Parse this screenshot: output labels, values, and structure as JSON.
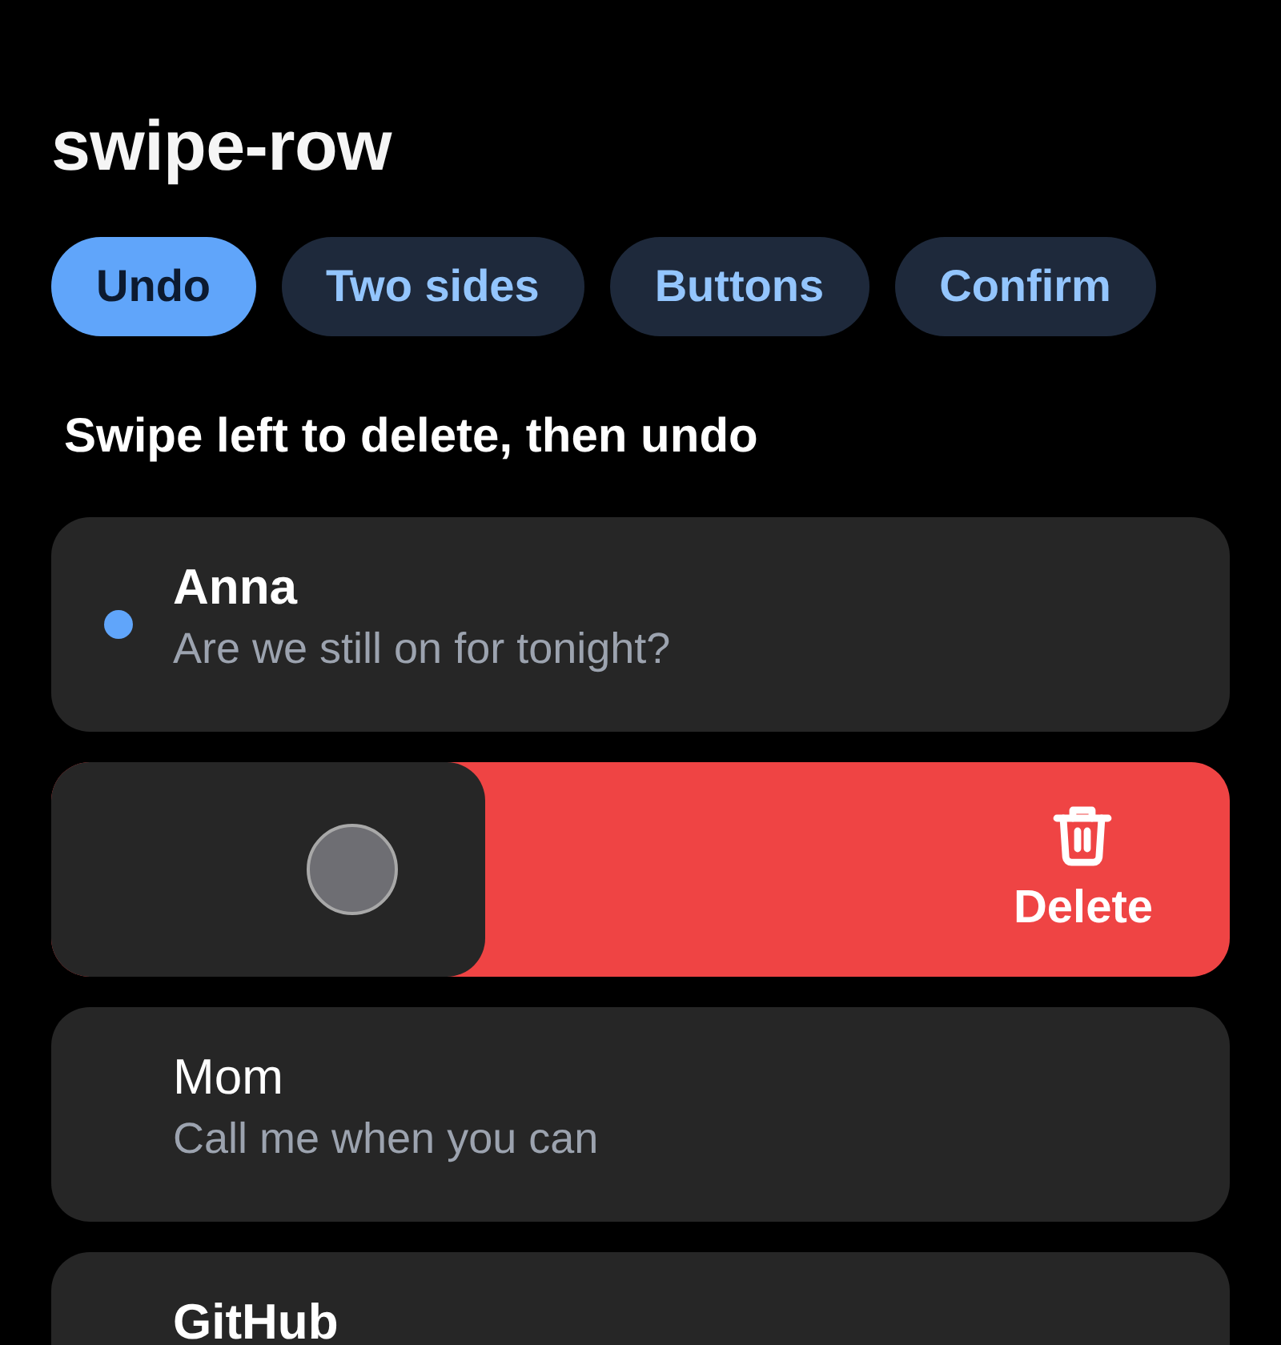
{
  "title": "swipe-row",
  "tabs": [
    {
      "label": "Undo",
      "selected": true
    },
    {
      "label": "Two sides",
      "selected": false
    },
    {
      "label": "Buttons",
      "selected": false
    },
    {
      "label": "Confirm",
      "selected": false
    }
  ],
  "instruction": "Swipe left to delete, then undo",
  "rows": [
    {
      "kind": "message",
      "name": "Anna",
      "message": "Are we still on for tonight?",
      "unread": true
    },
    {
      "kind": "swiped",
      "action": {
        "label": "Delete"
      }
    },
    {
      "kind": "message",
      "name": "Mom",
      "message": "Call me when you can",
      "unread": false
    },
    {
      "kind": "message",
      "name": "GitHub",
      "unread": true
    }
  ]
}
